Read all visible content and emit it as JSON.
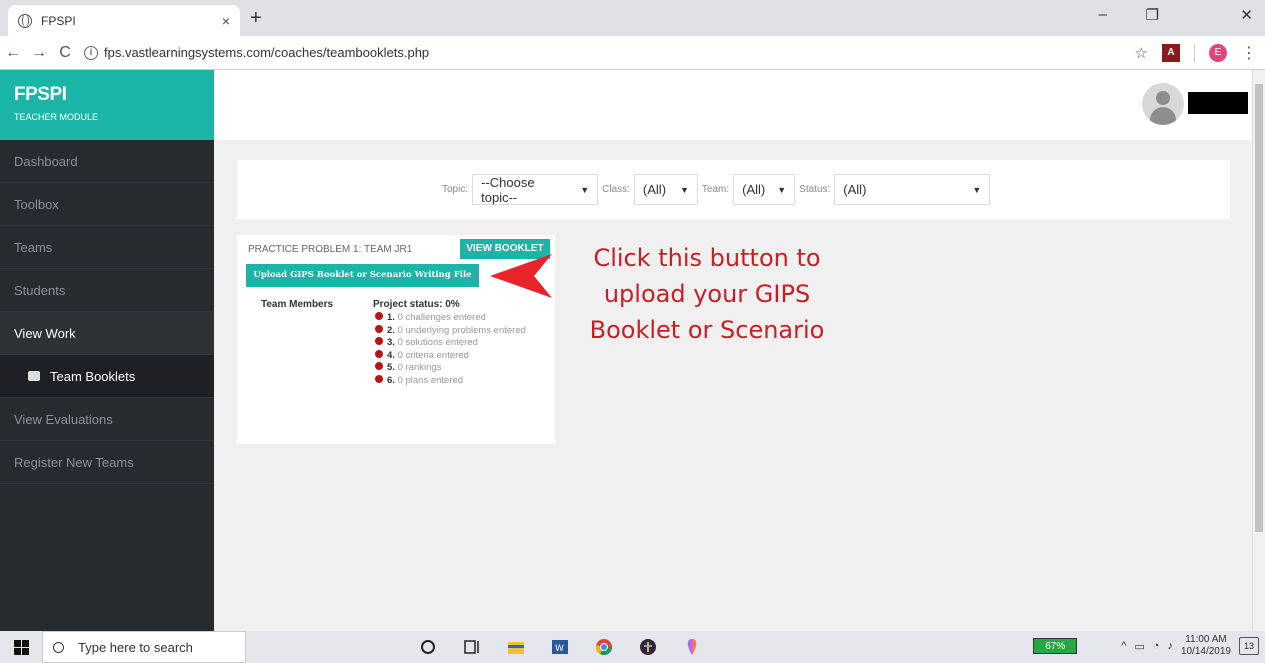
{
  "browser": {
    "tab_title": "FPSPI",
    "tab_close": "×",
    "new_tab": "+",
    "url": "fps.vastlearningsystems.com/coaches/teambooklets.php",
    "window_controls": {
      "minimize": "–",
      "maximize": "❐",
      "close": "✕"
    },
    "nav": {
      "back": "←",
      "forward": "→",
      "reload": "C"
    }
  },
  "app": {
    "brand_title": "FPSPI",
    "brand_subtitle": "TEACHER MODULE",
    "accent_color": "#1ab5a6",
    "sidebar": {
      "items": [
        {
          "label": "Dashboard"
        },
        {
          "label": "Toolbox"
        },
        {
          "label": "Teams"
        },
        {
          "label": "Students"
        },
        {
          "label": "View Work"
        },
        {
          "label": "Team Booklets"
        },
        {
          "label": "View Evaluations"
        },
        {
          "label": "Register New Teams"
        }
      ]
    }
  },
  "filters": {
    "topic_label": "Topic:",
    "topic_value": "--Choose topic--",
    "class_label": "Class:",
    "class_value": "(All)",
    "team_label": "Team:",
    "team_value": "(All)",
    "status_label": "Status:",
    "status_value": "(All)"
  },
  "card": {
    "title": "PRACTICE PROBLEM 1: TEAM JR1",
    "view_button": "VIEW BOOKLET",
    "upload_button": "Upload GIPS Booklet or Scenario Writing File",
    "members_label": "Team Members",
    "project_status": "Project status: 0%",
    "status_items": [
      {
        "num": "1.",
        "text": "0 challenges entered"
      },
      {
        "num": "2.",
        "text": "0 underlying problems entered"
      },
      {
        "num": "3.",
        "text": "0 solutions entered"
      },
      {
        "num": "4.",
        "text": "0 criteria entered"
      },
      {
        "num": "5.",
        "text": "0 rankings"
      },
      {
        "num": "6.",
        "text": "0 plans entered"
      }
    ]
  },
  "annotation": {
    "line1": "Click this button to",
    "line2": "upload your GIPS",
    "line3": "Booklet or Scenario",
    "color": "#c81f26"
  },
  "taskbar": {
    "search_placeholder": "Type here to search",
    "battery": "67%",
    "time": "11:00 AM",
    "date": "10/14/2019",
    "notifications": "13"
  }
}
